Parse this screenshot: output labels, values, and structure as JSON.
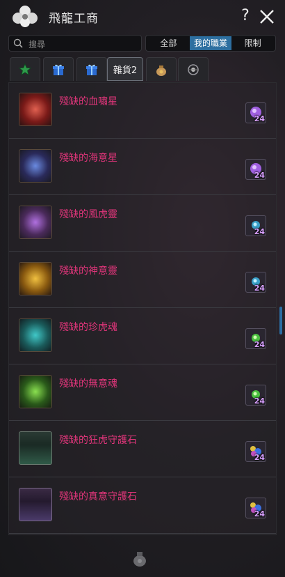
{
  "header": {
    "title": "飛龍工商",
    "help": "?"
  },
  "search": {
    "placeholder": "搜尋"
  },
  "filter": {
    "options": [
      "全部",
      "我的職業",
      "限制"
    ],
    "selected": "我的職業"
  },
  "tabs": [
    {
      "icon": "star-icon",
      "label": ""
    },
    {
      "icon": "gift-box-icon",
      "label": ""
    },
    {
      "icon": "gift-box-icon",
      "label": ""
    },
    {
      "icon": "",
      "label": "雜貨2"
    },
    {
      "icon": "money-bag-icon",
      "label": ""
    },
    {
      "icon": "orb-icon",
      "label": ""
    }
  ],
  "active_tab": "雜貨2",
  "items": [
    {
      "name": "殘缺的血嘯星",
      "icon": "blood-star-icon",
      "cost_icon": "purple-gem-icon",
      "cost": "24",
      "color": "#b2312a"
    },
    {
      "name": "殘缺的海意星",
      "icon": "sea-star-icon",
      "cost_icon": "purple-gem-icon",
      "cost": "24",
      "color": "#3a5aa8"
    },
    {
      "name": "殘缺的風虎靈",
      "icon": "wind-tiger-icon",
      "cost_icon": "blue-orb-icon",
      "cost": "24",
      "color": "#7a3ab8"
    },
    {
      "name": "殘缺的神意靈",
      "icon": "divine-spirit-icon",
      "cost_icon": "blue-orb-icon",
      "cost": "24",
      "color": "#c88a1a"
    },
    {
      "name": "殘缺的珍虎魂",
      "icon": "treasure-tiger-icon",
      "cost_icon": "green-orb-icon",
      "cost": "24",
      "color": "#2a9a9a"
    },
    {
      "name": "殘缺的無意魂",
      "icon": "void-soul-icon",
      "cost_icon": "green-orb-icon",
      "cost": "24",
      "color": "#4a9a2a"
    },
    {
      "name": "殘缺的狂虎守護石",
      "icon": "guardian-stone-icon",
      "cost_icon": "gem-cluster-icon",
      "cost": "24",
      "color": "#2a7a5a"
    },
    {
      "name": "殘缺的真意守護石",
      "icon": "guardian-stone-icon",
      "cost_icon": "gem-cluster-icon",
      "cost": "24",
      "color": "#7a4ab0"
    }
  ],
  "footer": {
    "icon": "money-bag-icon"
  },
  "colors": {
    "accent": "#2d6fa0",
    "item_name": "#e0357a"
  }
}
